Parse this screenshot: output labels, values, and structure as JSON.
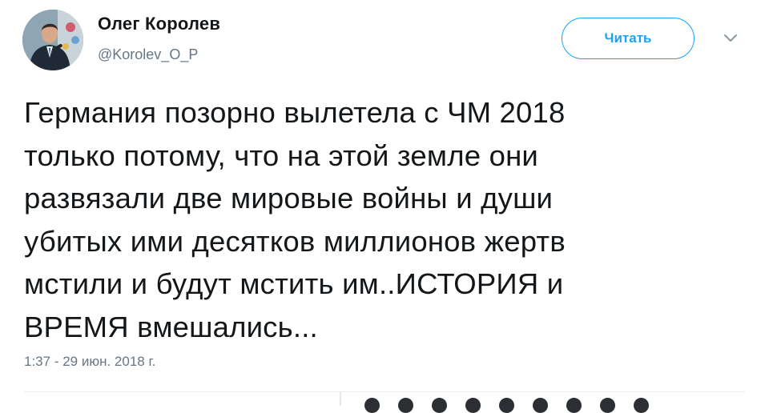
{
  "author": {
    "name": "Олег Королев",
    "handle": "@Korolev_O_P"
  },
  "actions": {
    "follow_label": "Читать",
    "more_icon": "chevron-down-icon"
  },
  "tweet": {
    "text_lines": [
      "Германия позорно вылетела с ЧМ 2018",
      "только потому, что на этой земле они",
      "развязали две мировые войны и души",
      "убитых ими десятков миллионов жертв",
      "мстили и будут мстить им..ИСТОРИЯ и",
      "ВРЕМЯ вмешались..."
    ],
    "timestamp": "1:37 - 29 июн. 2018 г."
  },
  "colors": {
    "accent": "#1da1f2",
    "text": "#14171a",
    "secondary": "#657786",
    "divider": "#e6ecf0"
  }
}
